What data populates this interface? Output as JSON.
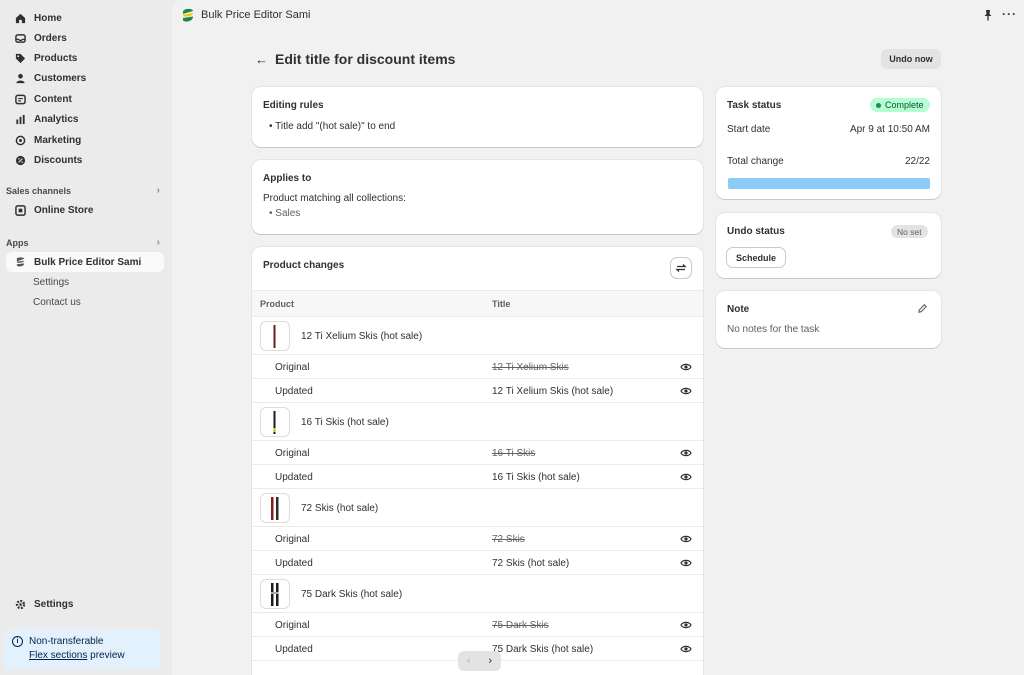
{
  "sidebar": {
    "nav": [
      {
        "label": "Home",
        "icon": "home-icon"
      },
      {
        "label": "Orders",
        "icon": "inbox-icon"
      },
      {
        "label": "Products",
        "icon": "tag-icon"
      },
      {
        "label": "Customers",
        "icon": "person-icon"
      },
      {
        "label": "Content",
        "icon": "content-icon"
      },
      {
        "label": "Analytics",
        "icon": "bar-chart-icon"
      },
      {
        "label": "Marketing",
        "icon": "target-icon"
      },
      {
        "label": "Discounts",
        "icon": "discount-icon"
      }
    ],
    "sales_channels_label": "Sales channels",
    "online_store": "Online Store",
    "apps_label": "Apps",
    "app_name": "Bulk Price Editor Sami",
    "app_sub": [
      "Settings",
      "Contact us"
    ],
    "settings": "Settings",
    "notice": {
      "line1": "Non-transferable",
      "link": "Flex sections",
      "tail": " preview"
    }
  },
  "topbar": {
    "app_name": "Bulk Price Editor Sami"
  },
  "page": {
    "title": "Edit title for discount items",
    "undo_button": "Undo now"
  },
  "editing_rules": {
    "title": "Editing rules",
    "rule": "Title add \"(hot sale)\" to end"
  },
  "applies_to": {
    "title": "Applies to",
    "text": "Product matching all collections:",
    "item": "Sales"
  },
  "product_changes": {
    "title": "Product changes",
    "col_product": "Product",
    "col_title": "Title",
    "original_label": "Original",
    "updated_label": "Updated",
    "products": [
      {
        "name": "12 Ti Xelium Skis (hot sale)",
        "original": "12 Ti Xelium Skis",
        "updated": "12 Ti Xelium Skis (hot sale)"
      },
      {
        "name": "16 Ti Skis (hot sale)",
        "original": "16 Ti Skis",
        "updated": "16 Ti Skis (hot sale)"
      },
      {
        "name": "72 Skis (hot sale)",
        "original": "72 Skis",
        "updated": "72 Skis (hot sale)"
      },
      {
        "name": "75 Dark Skis (hot sale)",
        "original": "75 Dark Skis",
        "updated": "75 Dark Skis (hot sale)"
      }
    ]
  },
  "task_status": {
    "title": "Task status",
    "badge": "Complete",
    "start_label": "Start date",
    "start_value": "Apr 9 at 10:50 AM",
    "total_label": "Total change",
    "total_value": "22/22",
    "progress": 1.0
  },
  "undo_status": {
    "title": "Undo status",
    "badge": "No set",
    "button": "Schedule"
  },
  "note": {
    "title": "Note",
    "text": "No notes for the task"
  },
  "colors": {
    "accent_progress": "#8ccbf7",
    "complete_badge": "#b4fed2",
    "notice_bg": "#e3f1fd"
  }
}
